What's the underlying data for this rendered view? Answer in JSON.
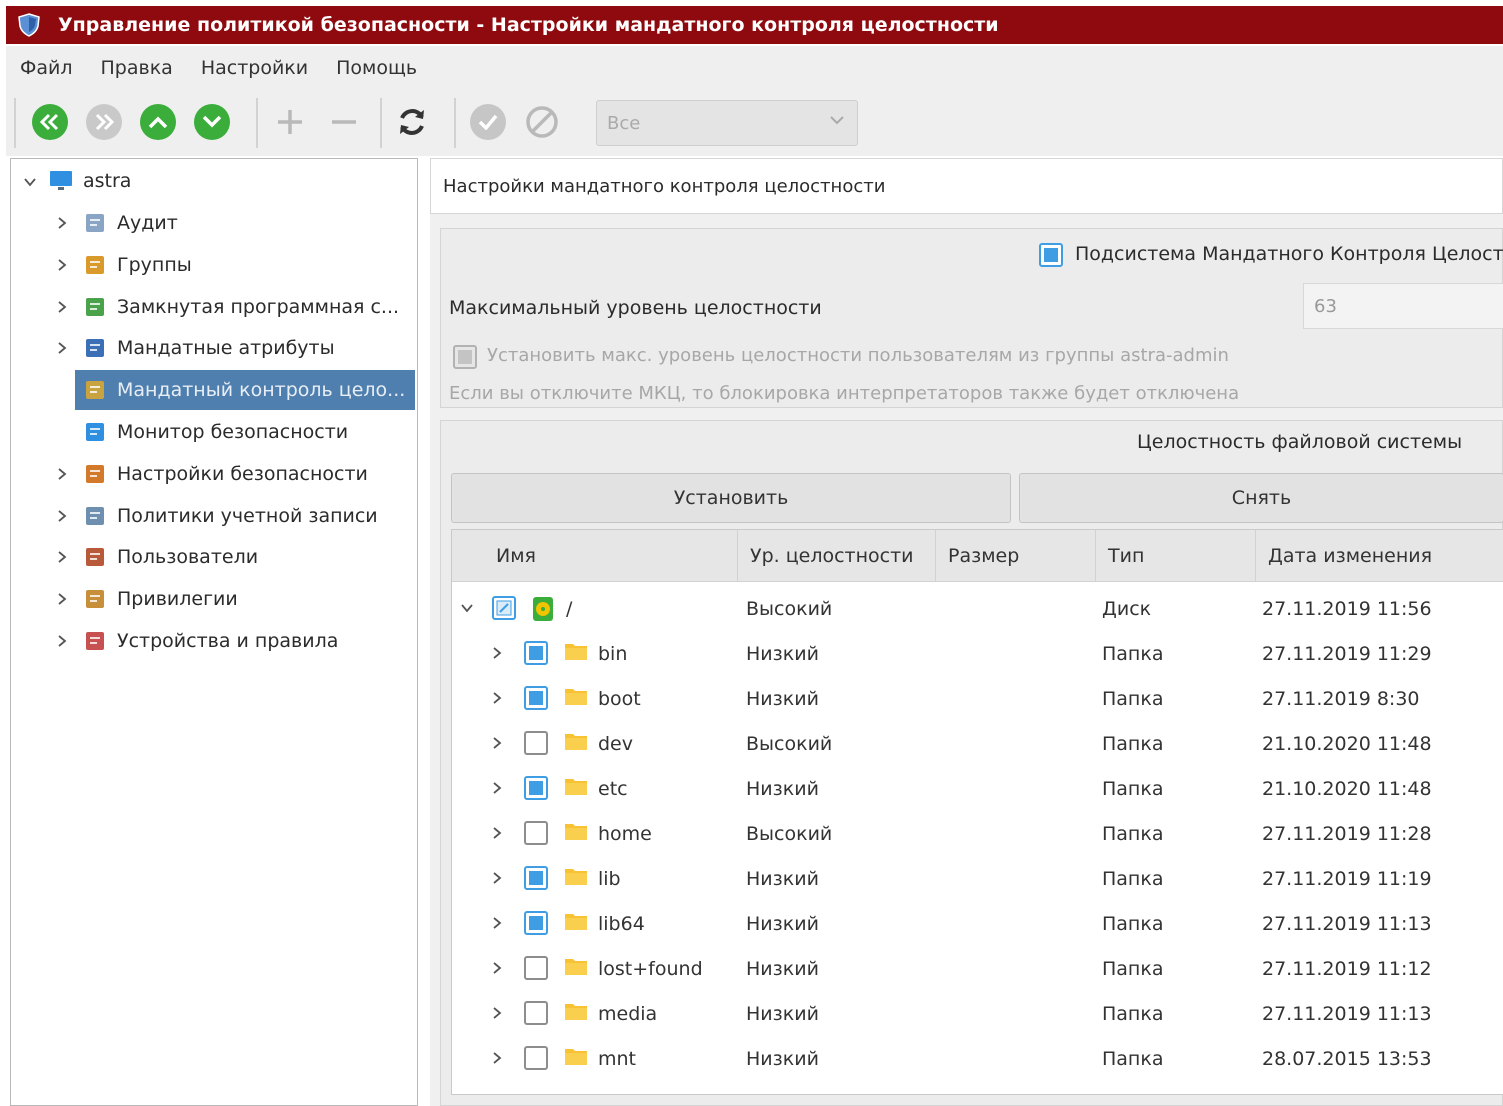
{
  "window": {
    "title": "Управление политикой безопасности - Настройки мандатного контроля целостности"
  },
  "menu": [
    "Файл",
    "Правка",
    "Настройки",
    "Помощь"
  ],
  "toolbar": {
    "filter_value": "Все"
  },
  "colors": {
    "titlebar": "#8e0a0e",
    "accent_green": "#3aad3a",
    "selection": "#4f7fae",
    "checkbox_blue": "#3f9ee3",
    "folder": "#f7c233"
  },
  "tree": {
    "root": "astra",
    "items": [
      {
        "label": "Аудит",
        "icon": "audit-icon"
      },
      {
        "label": "Группы",
        "icon": "groups-icon"
      },
      {
        "label": "Замкнутая программная с...",
        "icon": "closed-software-icon"
      },
      {
        "label": "Мандатные атрибуты",
        "icon": "mandatory-attributes-icon"
      },
      {
        "label": "Мандатный контроль цело...",
        "icon": "integrity-control-icon",
        "selected": true
      },
      {
        "label": "Монитор безопасности",
        "icon": "security-monitor-icon"
      },
      {
        "label": "Настройки безопасности",
        "icon": "security-settings-icon"
      },
      {
        "label": "Политики учетной записи",
        "icon": "account-policies-icon"
      },
      {
        "label": "Пользователи",
        "icon": "users-icon"
      },
      {
        "label": "Привилегии",
        "icon": "privileges-icon"
      },
      {
        "label": "Устройства и правила",
        "icon": "devices-rules-icon"
      }
    ]
  },
  "main": {
    "header": "Настройки мандатного контроля целостности",
    "subsystem_label": "Подсистема Мандатного Контроля Целост",
    "max_level_label": "Максимальный уровень целостности",
    "max_level_value": "63",
    "set_max_label": "Установить макс. уровень целостности пользователям из группы astra-admin",
    "warning": "Если вы отключите МКЦ, то блокировка интерпретаторов также будет отключена",
    "fs_group_title": "Целостность файловой системы",
    "set_button": "Установить",
    "unset_button": "Снять",
    "columns": [
      "Имя",
      "Ур. целостности",
      "Размер",
      "Тип",
      "Дата изменения"
    ],
    "root_row": {
      "name": "/",
      "level": "Высокий",
      "type": "Диск",
      "date": "27.11.2019 11:56"
    },
    "rows": [
      {
        "name": "bin",
        "checked": true,
        "level": "Низкий",
        "type": "Папка",
        "date": "27.11.2019 11:29"
      },
      {
        "name": "boot",
        "checked": true,
        "level": "Низкий",
        "type": "Папка",
        "date": "27.11.2019 8:30"
      },
      {
        "name": "dev",
        "checked": false,
        "level": "Высокий",
        "type": "Папка",
        "date": "21.10.2020 11:48"
      },
      {
        "name": "etc",
        "checked": true,
        "level": "Низкий",
        "type": "Папка",
        "date": "21.10.2020 11:48"
      },
      {
        "name": "home",
        "checked": false,
        "level": "Высокий",
        "type": "Папка",
        "date": "27.11.2019 11:28"
      },
      {
        "name": "lib",
        "checked": true,
        "level": "Низкий",
        "type": "Папка",
        "date": "27.11.2019 11:19"
      },
      {
        "name": "lib64",
        "checked": true,
        "level": "Низкий",
        "type": "Папка",
        "date": "27.11.2019 11:13"
      },
      {
        "name": "lost+found",
        "checked": false,
        "level": "Низкий",
        "type": "Папка",
        "date": "27.11.2019 11:12"
      },
      {
        "name": "media",
        "checked": false,
        "level": "Низкий",
        "type": "Папка",
        "date": "27.11.2019 11:13"
      },
      {
        "name": "mnt",
        "checked": false,
        "level": "Низкий",
        "type": "Папка",
        "date": "28.07.2015 13:53"
      }
    ]
  }
}
